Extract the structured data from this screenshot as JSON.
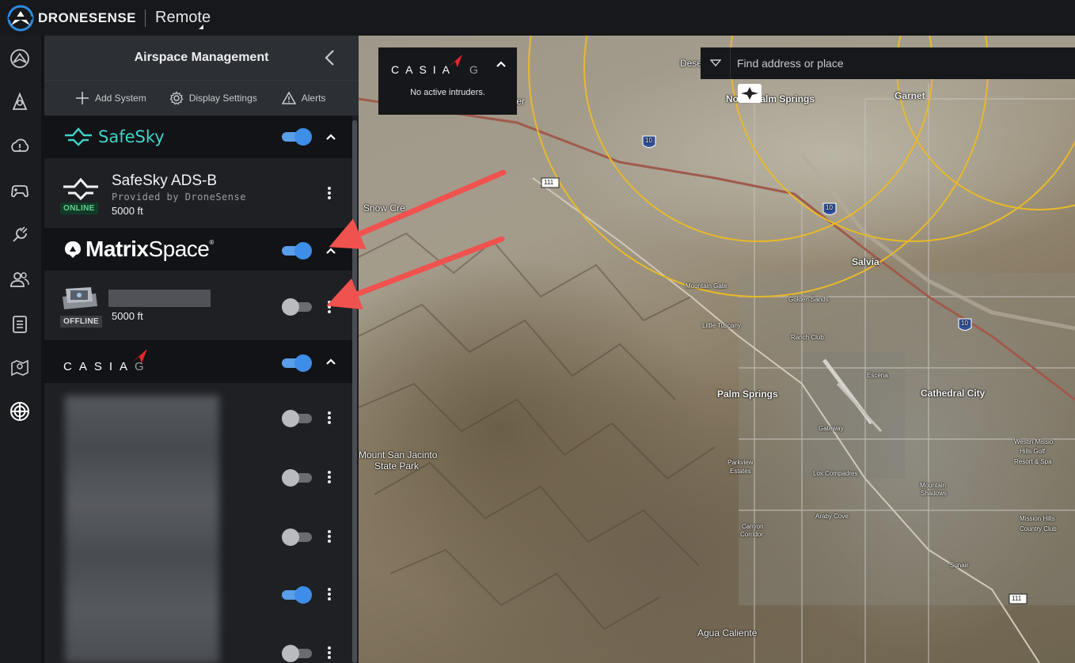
{
  "app": {
    "brand": "DRONESENSE",
    "product": "Remote"
  },
  "panel": {
    "title": "Airspace Management",
    "toolbar": {
      "add_system": "Add System",
      "display_settings": "Display Settings",
      "alerts": "Alerts"
    }
  },
  "sections": {
    "safesky": {
      "logo_text": "SafeSky",
      "enabled": true,
      "accent": "#3fd3c8"
    },
    "matrixspace": {
      "logo_bold": "Matrix",
      "logo_light": "Space",
      "trademark": "®",
      "enabled": true
    },
    "casia": {
      "logo_text": "CASIA",
      "logo_suffix": "G",
      "enabled": true
    }
  },
  "devices": {
    "safesky_adsb": {
      "name": "SafeSky ADS-B",
      "provider": "Provided by DroneSense",
      "status": "ONLINE",
      "altitude": "5000 ft",
      "enabled": false
    },
    "matrix_device": {
      "status": "OFFLINE",
      "altitude": "5000 ft",
      "enabled": false
    },
    "casia_devices": [
      {
        "enabled": false
      },
      {
        "enabled": false
      },
      {
        "enabled": false
      },
      {
        "enabled": true
      },
      {
        "enabled": false
      }
    ]
  },
  "map": {
    "casia_overlay": {
      "message": "No active intruders."
    },
    "search": {
      "placeholder": "Find address or place"
    },
    "labels": {
      "north_palm_springs": "North Palm Springs",
      "garnet": "Garnet",
      "snow_creek": "Snow Cre",
      "desert": "Dese",
      "center": "ter",
      "salvia": "Salvia",
      "mountain_gate": "Mountain Gate",
      "golden_sands": "Golden Sands",
      "little_tuscany": "Little Tuscany",
      "ranch_club": "Ranch Club",
      "palm_springs": "Palm Springs",
      "escena": "Escena",
      "cathedral_city": "Cathedral City",
      "mount_san_jacinto": "Mount San Jacinto",
      "state_park": "State Park",
      "gateway": "Gateway",
      "parkview": "Parkview",
      "estates": "Estates",
      "los_compadres": "Los Compadres",
      "mountain": "Mountain",
      "shadows": "Shadows",
      "westin_1": "Westin Missio",
      "westin_2": "Hills Golf",
      "westin_3": "Resort & Spa",
      "canyon": "Canyon",
      "corridor": "Corridor",
      "araby_cove": "Araby Cove",
      "mission_hills_1": "Mission Hills",
      "mission_hills_2": "Country Club",
      "sunair": "Sunair",
      "agua_caliente": "Agua Caliente",
      "hwy_111_a": "111",
      "hwy_111_b": "111",
      "i10_a": "10",
      "i10_b": "10",
      "i10_c": "10"
    }
  },
  "colors": {
    "accent_blue": "#3e8ee8",
    "annotation_red": "#f0524f",
    "airspace_ring": "#e8b92a"
  }
}
